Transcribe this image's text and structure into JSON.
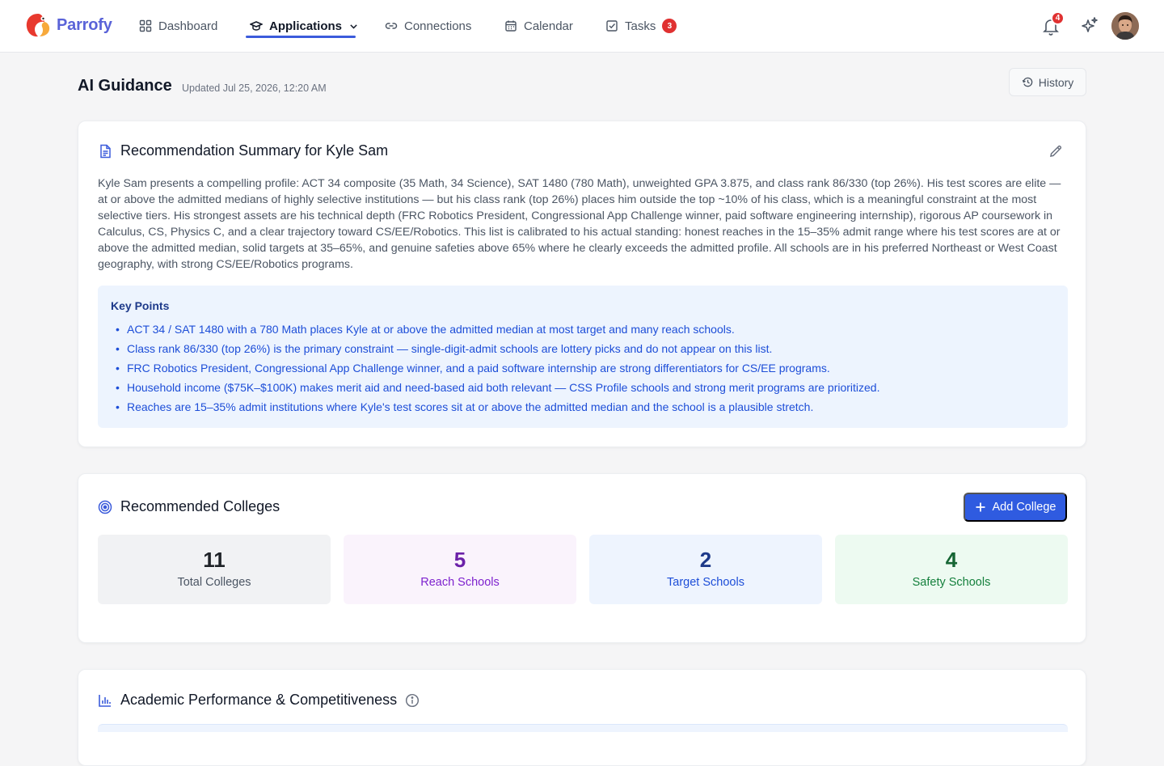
{
  "app": {
    "name": "Parrofy",
    "colors": {
      "brand": "#5a63d8",
      "accent": "#2f5be0",
      "badge": "#e03131"
    }
  },
  "nav": {
    "items": [
      {
        "label": "Dashboard",
        "icon": "grid-icon"
      },
      {
        "label": "Applications",
        "icon": "graduation-cap-icon",
        "active": true
      },
      {
        "label": "Connections",
        "icon": "link-icon"
      },
      {
        "label": "Calendar",
        "icon": "calendar-icon"
      },
      {
        "label": "Tasks",
        "icon": "checkbox-icon",
        "badge": "3"
      }
    ],
    "notifications_count": "4"
  },
  "page": {
    "title": "AI Guidance",
    "updated": "Updated Jul 25, 2026, 12:20 AM",
    "history_label": "History"
  },
  "summary": {
    "title": "Recommendation Summary for Kyle Sam",
    "text": "Kyle Sam presents a compelling profile: ACT 34 composite (35 Math, 34 Science), SAT 1480 (780 Math), unweighted GPA 3.875, and class rank 86/330 (top 26%). His test scores are elite — at or above the admitted medians of highly selective institutions — but his class rank (top 26%) places him outside the top ~10% of his class, which is a meaningful constraint at the most selective tiers. His strongest assets are his technical depth (FRC Robotics President, Congressional App Challenge winner, paid software engineering internship), rigorous AP coursework in Calculus, CS, Physics C, and a clear trajectory toward CS/EE/Robotics. This list is calibrated to his actual standing: honest reaches in the 15–35% admit range where his test scores are at or above the admitted median, solid targets at 35–65%, and genuine safeties above 65% where he clearly exceeds the admitted profile. All schools are in his preferred Northeast or West Coast geography, with strong CS/EE/Robotics programs.",
    "key_points_title": "Key Points",
    "key_points": [
      "ACT 34 / SAT 1480 with a 780 Math places Kyle at or above the admitted median at most target and many reach schools.",
      "Class rank 86/330 (top 26%) is the primary constraint — single-digit-admit schools are lottery picks and do not appear on this list.",
      "FRC Robotics President, Congressional App Challenge winner, and a paid software internship are strong differentiators for CS/EE programs.",
      "Household income ($75K–$100K) makes merit aid and need-based aid both relevant — CSS Profile schools and strong merit programs are prioritized.",
      "Reaches are 15–35% admit institutions where Kyle's test scores sit at or above the admitted median and the school is a plausible stretch."
    ]
  },
  "colleges": {
    "title": "Recommended Colleges",
    "add_label": "Add College",
    "stats": {
      "total": {
        "value": "11",
        "label": "Total Colleges"
      },
      "reach": {
        "value": "5",
        "label": "Reach Schools"
      },
      "target": {
        "value": "2",
        "label": "Target Schools"
      },
      "safety": {
        "value": "4",
        "label": "Safety Schools"
      }
    }
  },
  "academic": {
    "title": "Academic Performance & Competitiveness"
  }
}
